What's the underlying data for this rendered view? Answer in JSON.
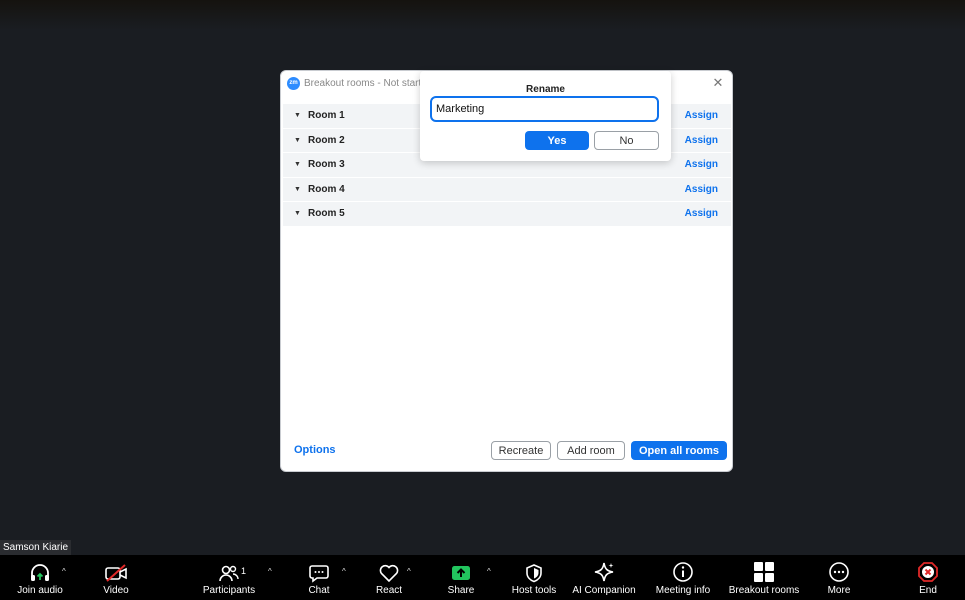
{
  "dialog": {
    "title": "Breakout rooms - Not started",
    "logo": "zm",
    "close_icon": "✕",
    "rooms": [
      {
        "name": "Room 1",
        "assign": "Assign"
      },
      {
        "name": "Room 2",
        "assign": "Assign"
      },
      {
        "name": "Room 3",
        "assign": "Assign"
      },
      {
        "name": "Room 4",
        "assign": "Assign"
      },
      {
        "name": "Room 5",
        "assign": "Assign"
      }
    ],
    "footer": {
      "options": "Options",
      "recreate": "Recreate",
      "add_room": "Add room",
      "open_all": "Open all rooms"
    }
  },
  "rename": {
    "title": "Rename",
    "value": "Marketing",
    "yes": "Yes",
    "no": "No"
  },
  "name_tag": "Samson Kiarie",
  "toolbar": {
    "join_audio": "Join audio",
    "video": "Video",
    "participants": "Participants",
    "participants_count": "1",
    "chat": "Chat",
    "react": "React",
    "share": "Share",
    "host_tools": "Host tools",
    "ai_companion": "AI Companion",
    "meeting_info": "Meeting info",
    "breakout_rooms": "Breakout rooms",
    "more": "More",
    "end": "End"
  },
  "colors": {
    "accent": "#0e72ed",
    "share_green": "#22c55e",
    "end_red": "#e02828",
    "video_off_red": "#e02828"
  }
}
